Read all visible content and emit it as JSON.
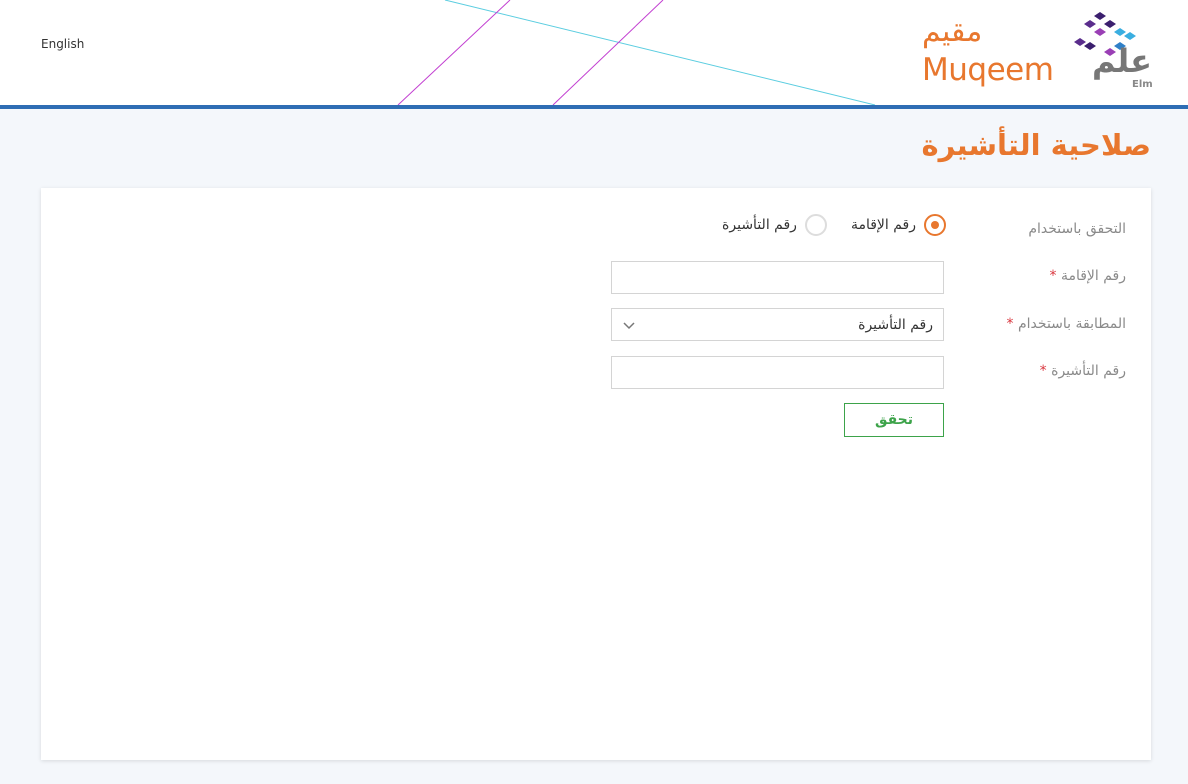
{
  "header": {
    "language_link": "English",
    "brand_name_ar": "مقيم",
    "brand_name_en": "Muqeem",
    "elm_name_ar": "علم",
    "elm_name_en": "Elm"
  },
  "page": {
    "title": "صلاحية التأشيرة"
  },
  "form": {
    "verify_by_label": "التحقق باستخدام",
    "radio_options": [
      {
        "label": "رقم الإقامة",
        "checked": true
      },
      {
        "label": "رقم التأشيرة",
        "checked": false
      }
    ],
    "iqama_label": "رقم الإقامة",
    "iqama_value": "",
    "match_label": "المطابقة باستخدام",
    "match_selected": "رقم التأشيرة",
    "visa_label": "رقم التأشيرة",
    "visa_value": "",
    "required_mark": "*",
    "submit_label": "تحقق"
  },
  "colors": {
    "accent": "#e8772e",
    "header_border": "#2e6db4",
    "button": "#3da34a",
    "required": "#d9363e"
  }
}
